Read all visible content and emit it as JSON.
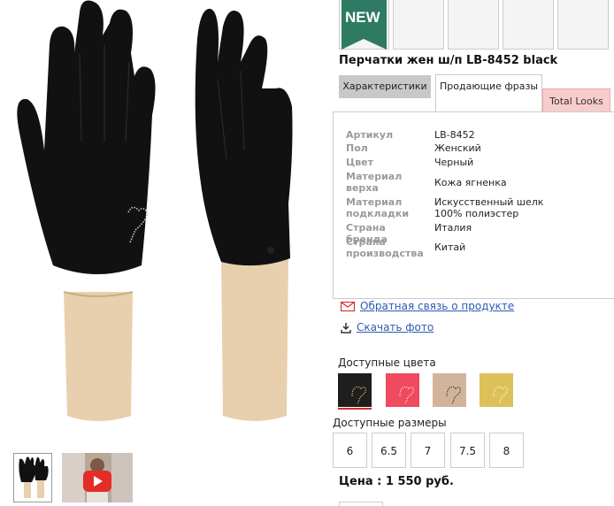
{
  "product": {
    "title": "Перчатки жен ш/п LB-8452 black",
    "price": "Цена : 1 550 руб."
  },
  "badge": {
    "label": "NEW"
  },
  "tabs": {
    "characteristics": "Характеристики",
    "phrases": "Продающие фразы",
    "total_looks": "Total Looks"
  },
  "specs": [
    {
      "label": "Артикул",
      "value": "LB-8452"
    },
    {
      "label": "Пол",
      "value": "Женский"
    },
    {
      "label": "Цвет",
      "value": "Черный"
    },
    {
      "label": "Материал верха",
      "value": "Кожа ягненка"
    },
    {
      "label": "Материал подкладки",
      "value": "Искусственный шелк 100% полиэстер"
    },
    {
      "label": "Страна бренда",
      "value": "Италия"
    },
    {
      "label": "Страна производства",
      "value": "Китай"
    }
  ],
  "links": {
    "feedback": "Обратная связь о продукте",
    "download": "Скачать фото"
  },
  "colors": {
    "label": "Доступные цвета",
    "swatches": [
      "#1e1e1e",
      "#ef4a5e",
      "#d2b49c",
      "#dcc05a"
    ]
  },
  "sizes": {
    "label": "Доступные размеры",
    "options": [
      "6",
      "6.5",
      "7",
      "7.5",
      "8"
    ]
  },
  "theme": {
    "badge_green": "#2e7a63",
    "tab_looks_bg": "#f9cccc",
    "link_color": "#2a5db0"
  }
}
